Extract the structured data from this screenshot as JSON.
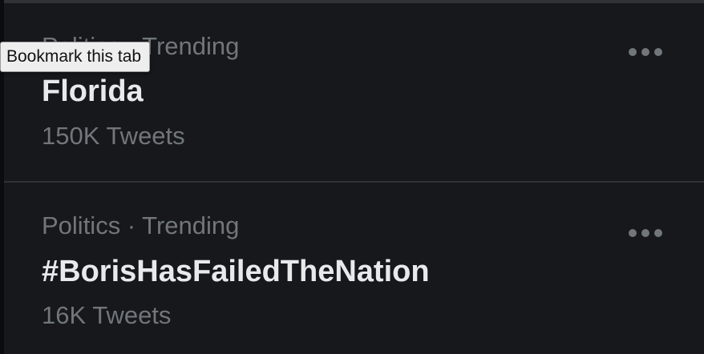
{
  "colors": {
    "background": "#16181c",
    "divider": "#2f3336",
    "primary_text": "#e7e9ea",
    "secondary_text": "#71767b",
    "tooltip_background": "#eeeeee"
  },
  "tooltip": {
    "text": "Bookmark this tab"
  },
  "trends": [
    {
      "context": "Politics · Trending",
      "topic": "Florida",
      "count": "150K Tweets",
      "more_icon": "more-horizontal-icon"
    },
    {
      "context": "Politics · Trending",
      "topic": "#BorisHasFailedTheNation",
      "count": "16K Tweets",
      "more_icon": "more-horizontal-icon"
    }
  ]
}
